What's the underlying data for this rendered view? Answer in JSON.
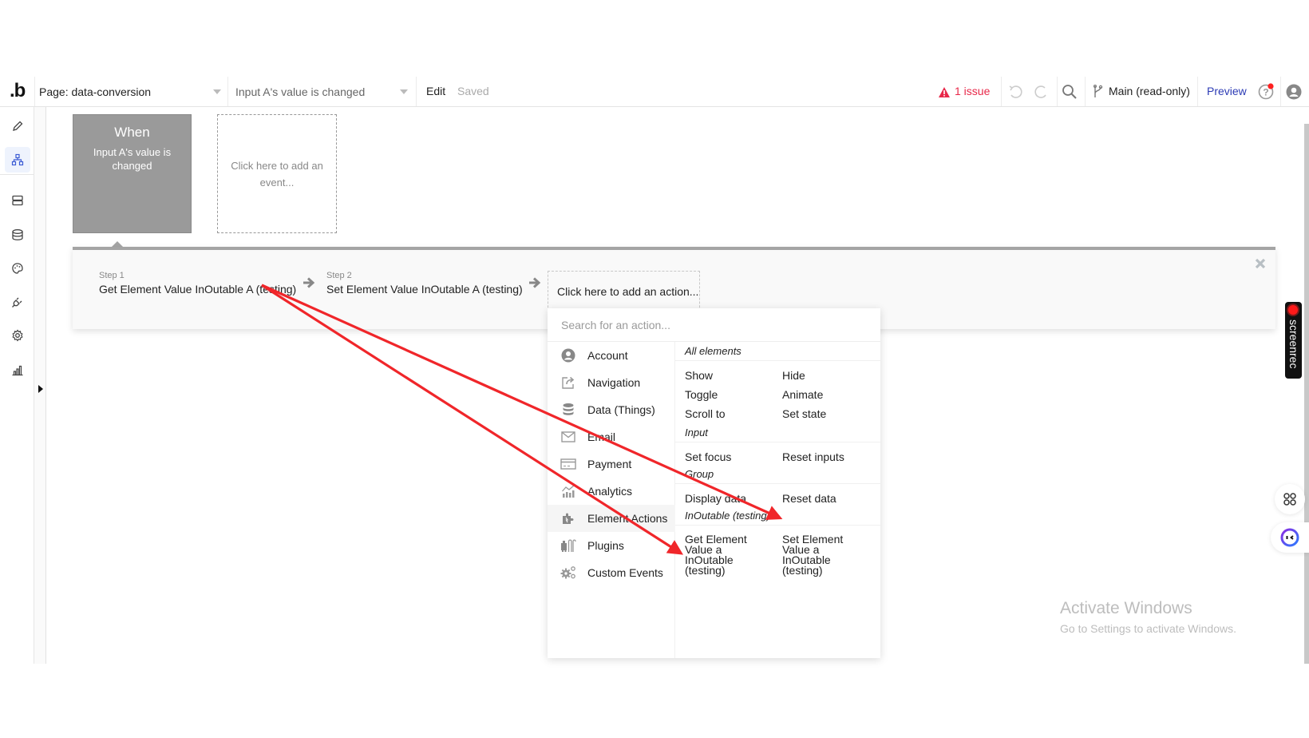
{
  "topbar": {
    "logo": ".b",
    "page_selector": "Page: data-conversion",
    "event_selector": "Input A's value is changed",
    "edit_label": "Edit",
    "saved_status": "Saved",
    "issues_label": "1 issue",
    "branch_label": "Main (read-only)",
    "preview_label": "Preview",
    "colors": {
      "issue": "#e8294a",
      "preview": "#2c3bb5",
      "notification_dot": "#ff2020"
    }
  },
  "sidebar": {
    "items": [
      {
        "icon": "pencil-icon",
        "label": "Design"
      },
      {
        "icon": "workflow-icon",
        "label": "Workflow",
        "active": true
      },
      {
        "icon": "data-icon",
        "label": "Data"
      },
      {
        "icon": "database-icon",
        "label": "Database"
      },
      {
        "icon": "palette-icon",
        "label": "Styles"
      },
      {
        "icon": "plug-icon",
        "label": "Plugins"
      },
      {
        "icon": "gear-icon",
        "label": "Settings"
      },
      {
        "icon": "chart-icon",
        "label": "Logs"
      }
    ]
  },
  "canvas": {
    "event_card": {
      "title": "When",
      "subtitle": "Input A's value is changed"
    },
    "add_event_label": "Click here to add an event..."
  },
  "steps": [
    {
      "label": "Step 1",
      "title": "Get Element Value InOutable A (testing)"
    },
    {
      "label": "Step 2",
      "title": "Set Element Value InOutable A (testing)"
    }
  ],
  "add_action_label": "Click here to add an action...",
  "action_menu": {
    "search_placeholder": "Search for an action...",
    "categories": [
      {
        "icon": "account-icon",
        "label": "Account"
      },
      {
        "icon": "navigation-icon",
        "label": "Navigation"
      },
      {
        "icon": "database-icon",
        "label": "Data (Things)"
      },
      {
        "icon": "email-icon",
        "label": "Email"
      },
      {
        "icon": "payment-icon",
        "label": "Payment"
      },
      {
        "icon": "analytics-icon",
        "label": "Analytics"
      },
      {
        "icon": "puzzle-icon",
        "label": "Element Actions",
        "active": true
      },
      {
        "icon": "plugins-icon",
        "label": "Plugins"
      },
      {
        "icon": "gears-icon",
        "label": "Custom Events"
      }
    ],
    "groups": [
      {
        "name": "All elements",
        "actions": [
          "Show",
          "Hide",
          "Toggle",
          "Animate",
          "Scroll to",
          "Set state"
        ]
      },
      {
        "name": "Input",
        "actions": [
          "Set focus",
          "Reset inputs"
        ]
      },
      {
        "name": "Group",
        "actions": [
          "Display data",
          "Reset data"
        ]
      },
      {
        "name": "InOutable (testing)",
        "actions": [
          "Get Element Value a InOutable (testing)",
          "Set Element Value a InOutable (testing)"
        ]
      }
    ]
  },
  "annotation": {
    "arrow_color": "#f0262a"
  },
  "overlay": {
    "screenrec_label": "screenrec",
    "watermark_title": "Activate Windows",
    "watermark_sub": "Go to Settings to activate Windows."
  }
}
